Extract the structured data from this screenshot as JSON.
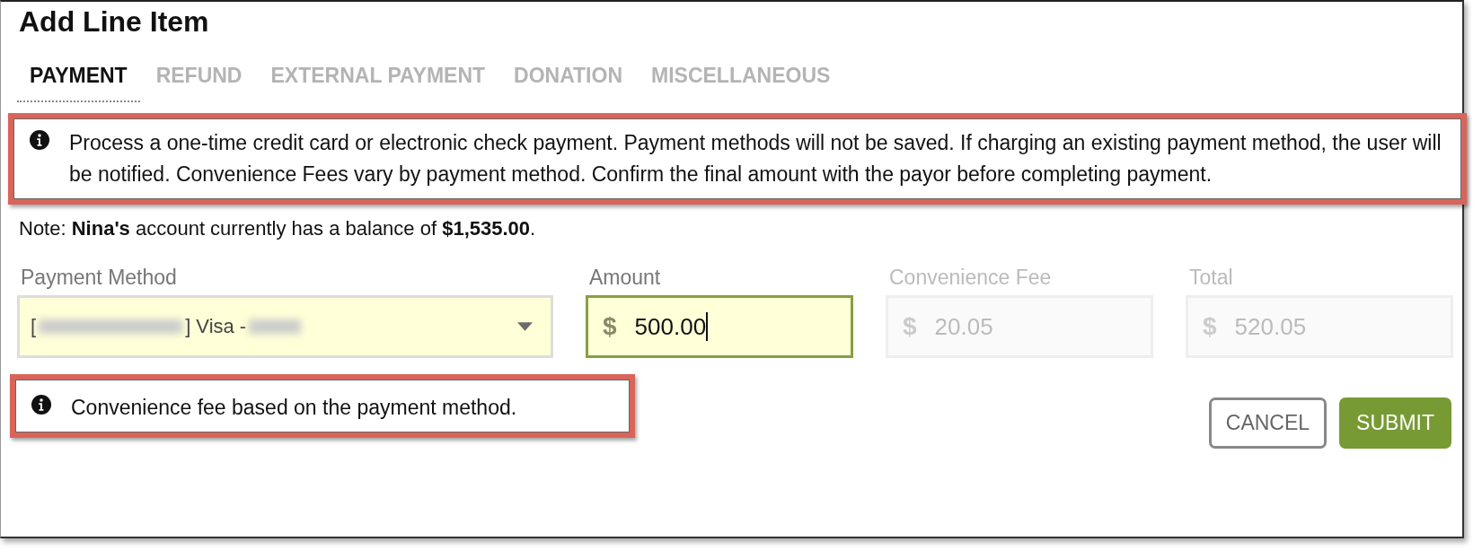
{
  "dialog": {
    "title": "Add Line Item"
  },
  "tabs": [
    {
      "label": "PAYMENT",
      "selected": true
    },
    {
      "label": "REFUND",
      "selected": false
    },
    {
      "label": "EXTERNAL PAYMENT",
      "selected": false
    },
    {
      "label": "DONATION",
      "selected": false
    },
    {
      "label": "MISCELLANEOUS",
      "selected": false
    }
  ],
  "info_notice": {
    "text": "Process a one-time credit card or electronic check payment. Payment methods will not be saved. If charging an existing payment method, the user will be notified. Convenience Fees vary by payment method. Confirm the final amount with the payor before completing payment.",
    "highlighted": true
  },
  "balance_note": "Note: **Nina's** account currently has a balance of **$1,535.00**.",
  "fields": [
    {
      "kind": "select",
      "label": "Payment Method",
      "value_start": "[",
      "value_end": "] Visa -",
      "redacted": true,
      "disabled": false,
      "focused": false
    },
    {
      "kind": "currency",
      "label": "Amount",
      "symbol": "$",
      "value": "500.00",
      "disabled": false,
      "focused": true
    },
    {
      "kind": "currency",
      "label": "Convenience Fee",
      "symbol": "$",
      "value": "20.05",
      "disabled": true,
      "focused": false
    },
    {
      "kind": "currency",
      "label": "Total",
      "symbol": "$",
      "value": "520.05",
      "disabled": true,
      "focused": false
    }
  ],
  "fee_notice": {
    "text": "Convenience fee based on the payment method.",
    "highlighted": true
  },
  "buttons": [
    {
      "kind": "outline",
      "label": "CANCEL"
    },
    {
      "kind": "primary",
      "label": "SUBMIT"
    }
  ]
}
